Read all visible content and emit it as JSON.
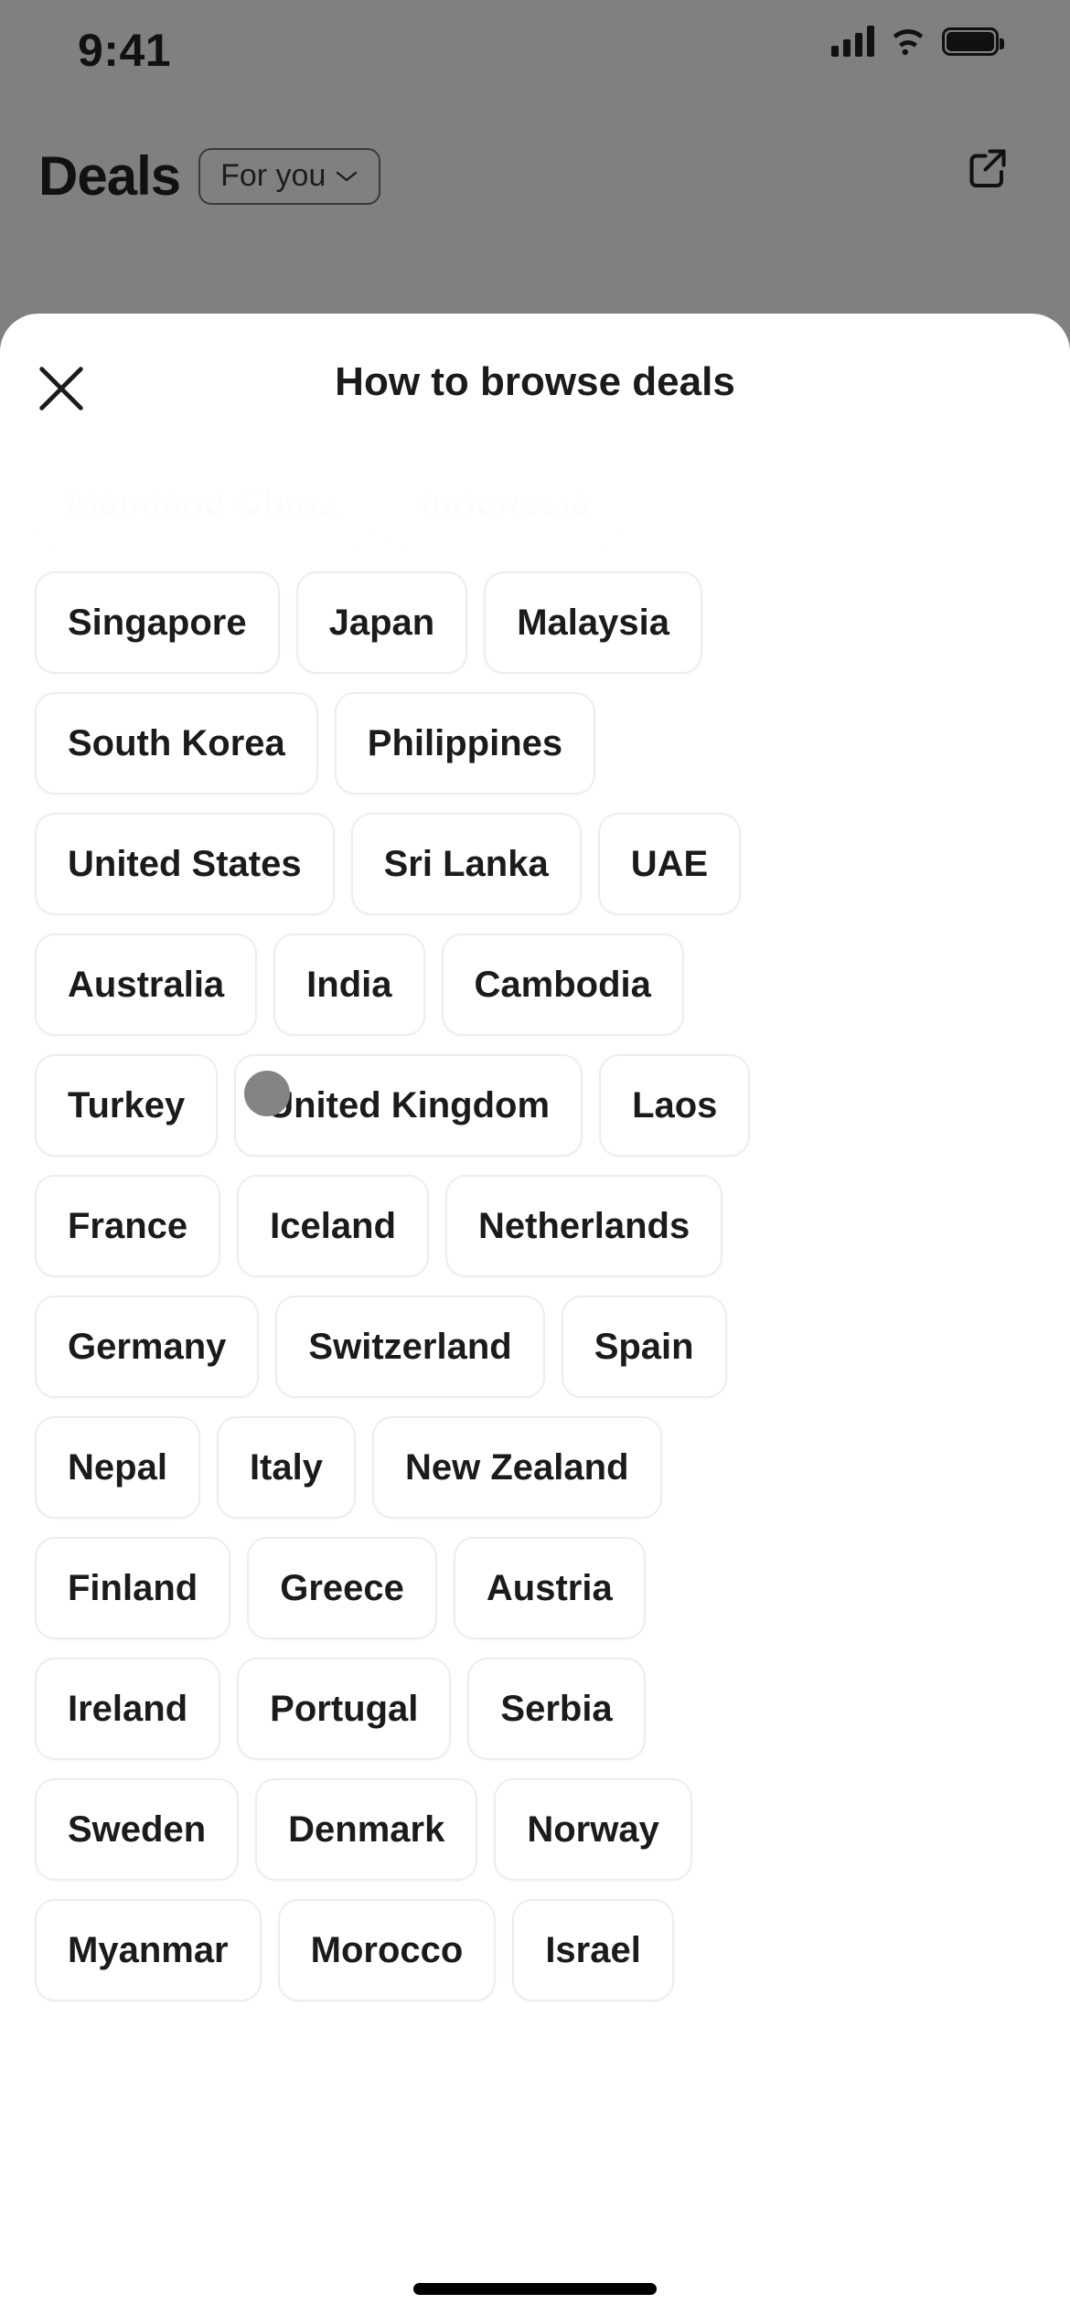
{
  "status_bar": {
    "time": "9:41",
    "cellular_icon": "signal-bars-icon",
    "wifi_icon": "wifi-icon",
    "battery_icon": "battery-full-icon"
  },
  "background_app": {
    "page_title": "Deals",
    "filter_chip_label": "For you",
    "filter_chip_caret_icon": "chevron-down-icon",
    "share_icon": "share-external-icon"
  },
  "sheet": {
    "close_icon": "close-x-icon",
    "title": "How to browse deals",
    "chip_rows": [
      {
        "faded": 2,
        "chips": [
          "Mainland China",
          "Indonesia"
        ]
      },
      {
        "faded": 0,
        "chips": [
          "Singapore",
          "Japan",
          "Malaysia"
        ]
      },
      {
        "faded": 0,
        "chips": [
          "South Korea",
          "Philippines"
        ]
      },
      {
        "faded": 0,
        "chips": [
          "United States",
          "Sri Lanka",
          "UAE"
        ]
      },
      {
        "faded": 0,
        "chips": [
          "Australia",
          "India",
          "Cambodia"
        ]
      },
      {
        "faded": 0,
        "chips": [
          "Turkey",
          "United Kingdom",
          "Laos"
        ]
      },
      {
        "faded": 0,
        "chips": [
          "France",
          "Iceland",
          "Netherlands"
        ]
      },
      {
        "faded": 0,
        "chips": [
          "Germany",
          "Switzerland",
          "Spain"
        ]
      },
      {
        "faded": 0,
        "chips": [
          "Nepal",
          "Italy",
          "New Zealand"
        ]
      },
      {
        "faded": 0,
        "chips": [
          "Finland",
          "Greece",
          "Austria"
        ]
      },
      {
        "faded": 0,
        "chips": [
          "Ireland",
          "Portugal",
          "Serbia"
        ]
      },
      {
        "faded": 0,
        "chips": [
          "Sweden",
          "Denmark",
          "Norway"
        ]
      },
      {
        "faded": 0,
        "chips": [
          "Myanmar",
          "Morocco",
          "Israel"
        ]
      }
    ]
  },
  "overlay": {
    "touch_indicator": "touch-point-indicator",
    "touch_color": "#848484"
  },
  "home_indicator": "home-indicator-bar",
  "colors": {
    "backdrop_dim": "#808080",
    "sheet_background": "#ffffff",
    "chip_border": "#ededed",
    "text_primary": "#1b1b1b"
  }
}
